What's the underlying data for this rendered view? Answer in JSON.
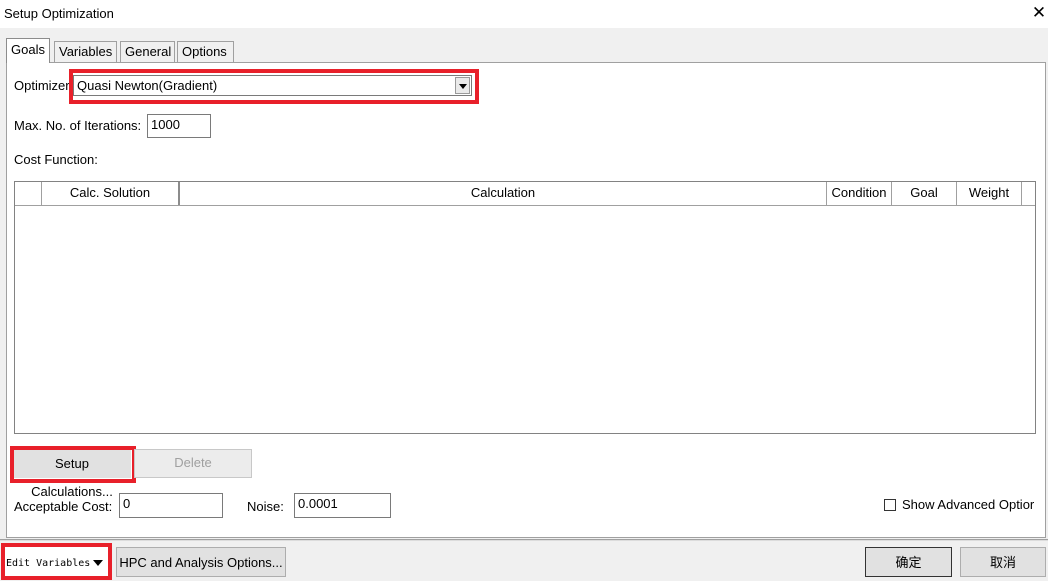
{
  "window": {
    "title": "Setup Optimization",
    "close_glyph": "✕"
  },
  "tabs": [
    {
      "label": "Goals",
      "active": true
    },
    {
      "label": "Variables"
    },
    {
      "label": "General"
    },
    {
      "label": "Options"
    }
  ],
  "goals": {
    "optimizer_label": "Optimizer",
    "optimizer_value": "Quasi Newton(Gradient)",
    "max_iter_label": "Max. No. of Iterations:",
    "max_iter_value": "1000",
    "cost_function_label": "Cost Function:",
    "table_columns": [
      "",
      "Calc. Solution",
      "Calculation",
      "Condition",
      "Goal",
      "Weight"
    ],
    "setup_calc_button": "Setup Calculations...",
    "delete_button": "Delete",
    "acceptable_cost_label": "Acceptable Cost:",
    "acceptable_cost_value": "0",
    "noise_label": "Noise:",
    "noise_value": "0.0001",
    "show_advanced_label": "Show Advanced Optior"
  },
  "footer": {
    "edit_variables": "Edit Variables",
    "hpc_button": "HPC and Analysis Options...",
    "ok_button": "确定",
    "cancel_button": "取消"
  },
  "highlight_color": "#e8202a"
}
